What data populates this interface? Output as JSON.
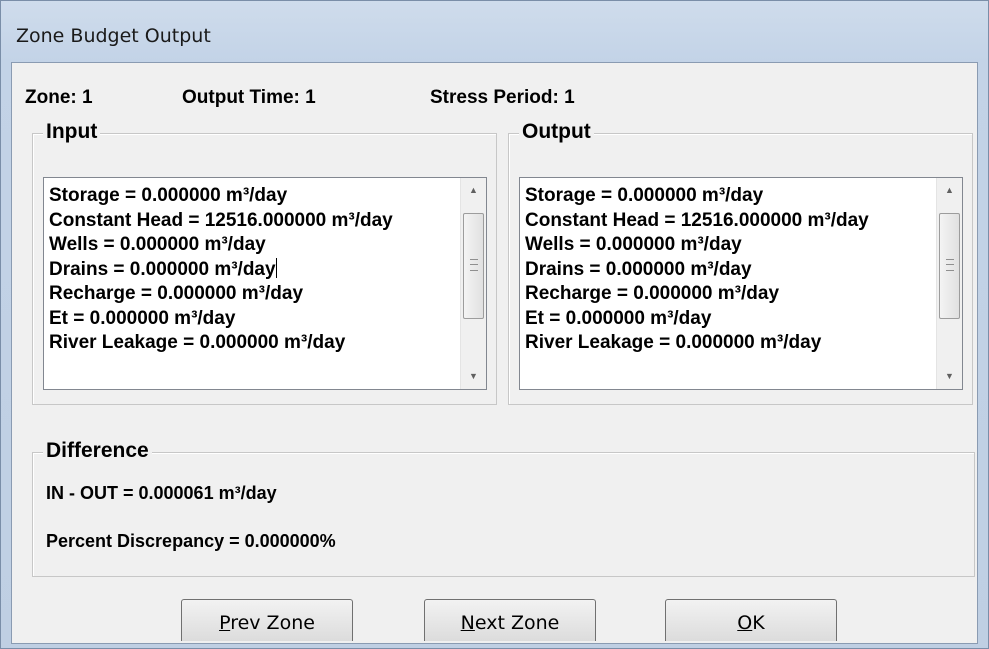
{
  "window": {
    "title": "Zone Budget Output"
  },
  "header": {
    "zone": "Zone: 1",
    "output_time": "Output Time: 1",
    "stress_period": "Stress Period: 1"
  },
  "input_group": {
    "label": "Input",
    "items": [
      "Storage = 0.000000 m³/day",
      "Constant Head = 12516.000000 m³/day",
      "Wells = 0.000000 m³/day",
      "Drains = 0.000000 m³/day",
      "Recharge = 0.000000 m³/day",
      "Et = 0.000000 m³/day",
      "River Leakage = 0.000000 m³/day"
    ]
  },
  "output_group": {
    "label": "Output",
    "items": [
      "Storage = 0.000000 m³/day",
      "Constant Head = 12516.000000 m³/day",
      "Wells = 0.000000 m³/day",
      "Drains = 0.000000 m³/day",
      "Recharge = 0.000000 m³/day",
      "Et = 0.000000 m³/day",
      "River Leakage = 0.000000 m³/day"
    ]
  },
  "difference_group": {
    "label": "Difference",
    "in_out": "IN - OUT = 0.000061 m³/day",
    "percent_discrepancy": "Percent Discrepancy = 0.000000%"
  },
  "buttons": {
    "prev": {
      "mnemonic": "P",
      "rest": "rev Zone"
    },
    "next": {
      "mnemonic": "N",
      "rest": "ext Zone"
    },
    "ok": {
      "mnemonic": "O",
      "rest": "K"
    }
  },
  "icons": {
    "scroll_up": "scroll-up-arrow-icon",
    "scroll_down": "scroll-down-arrow-icon",
    "scroll_grip": "scrollbar-grip-icon"
  }
}
